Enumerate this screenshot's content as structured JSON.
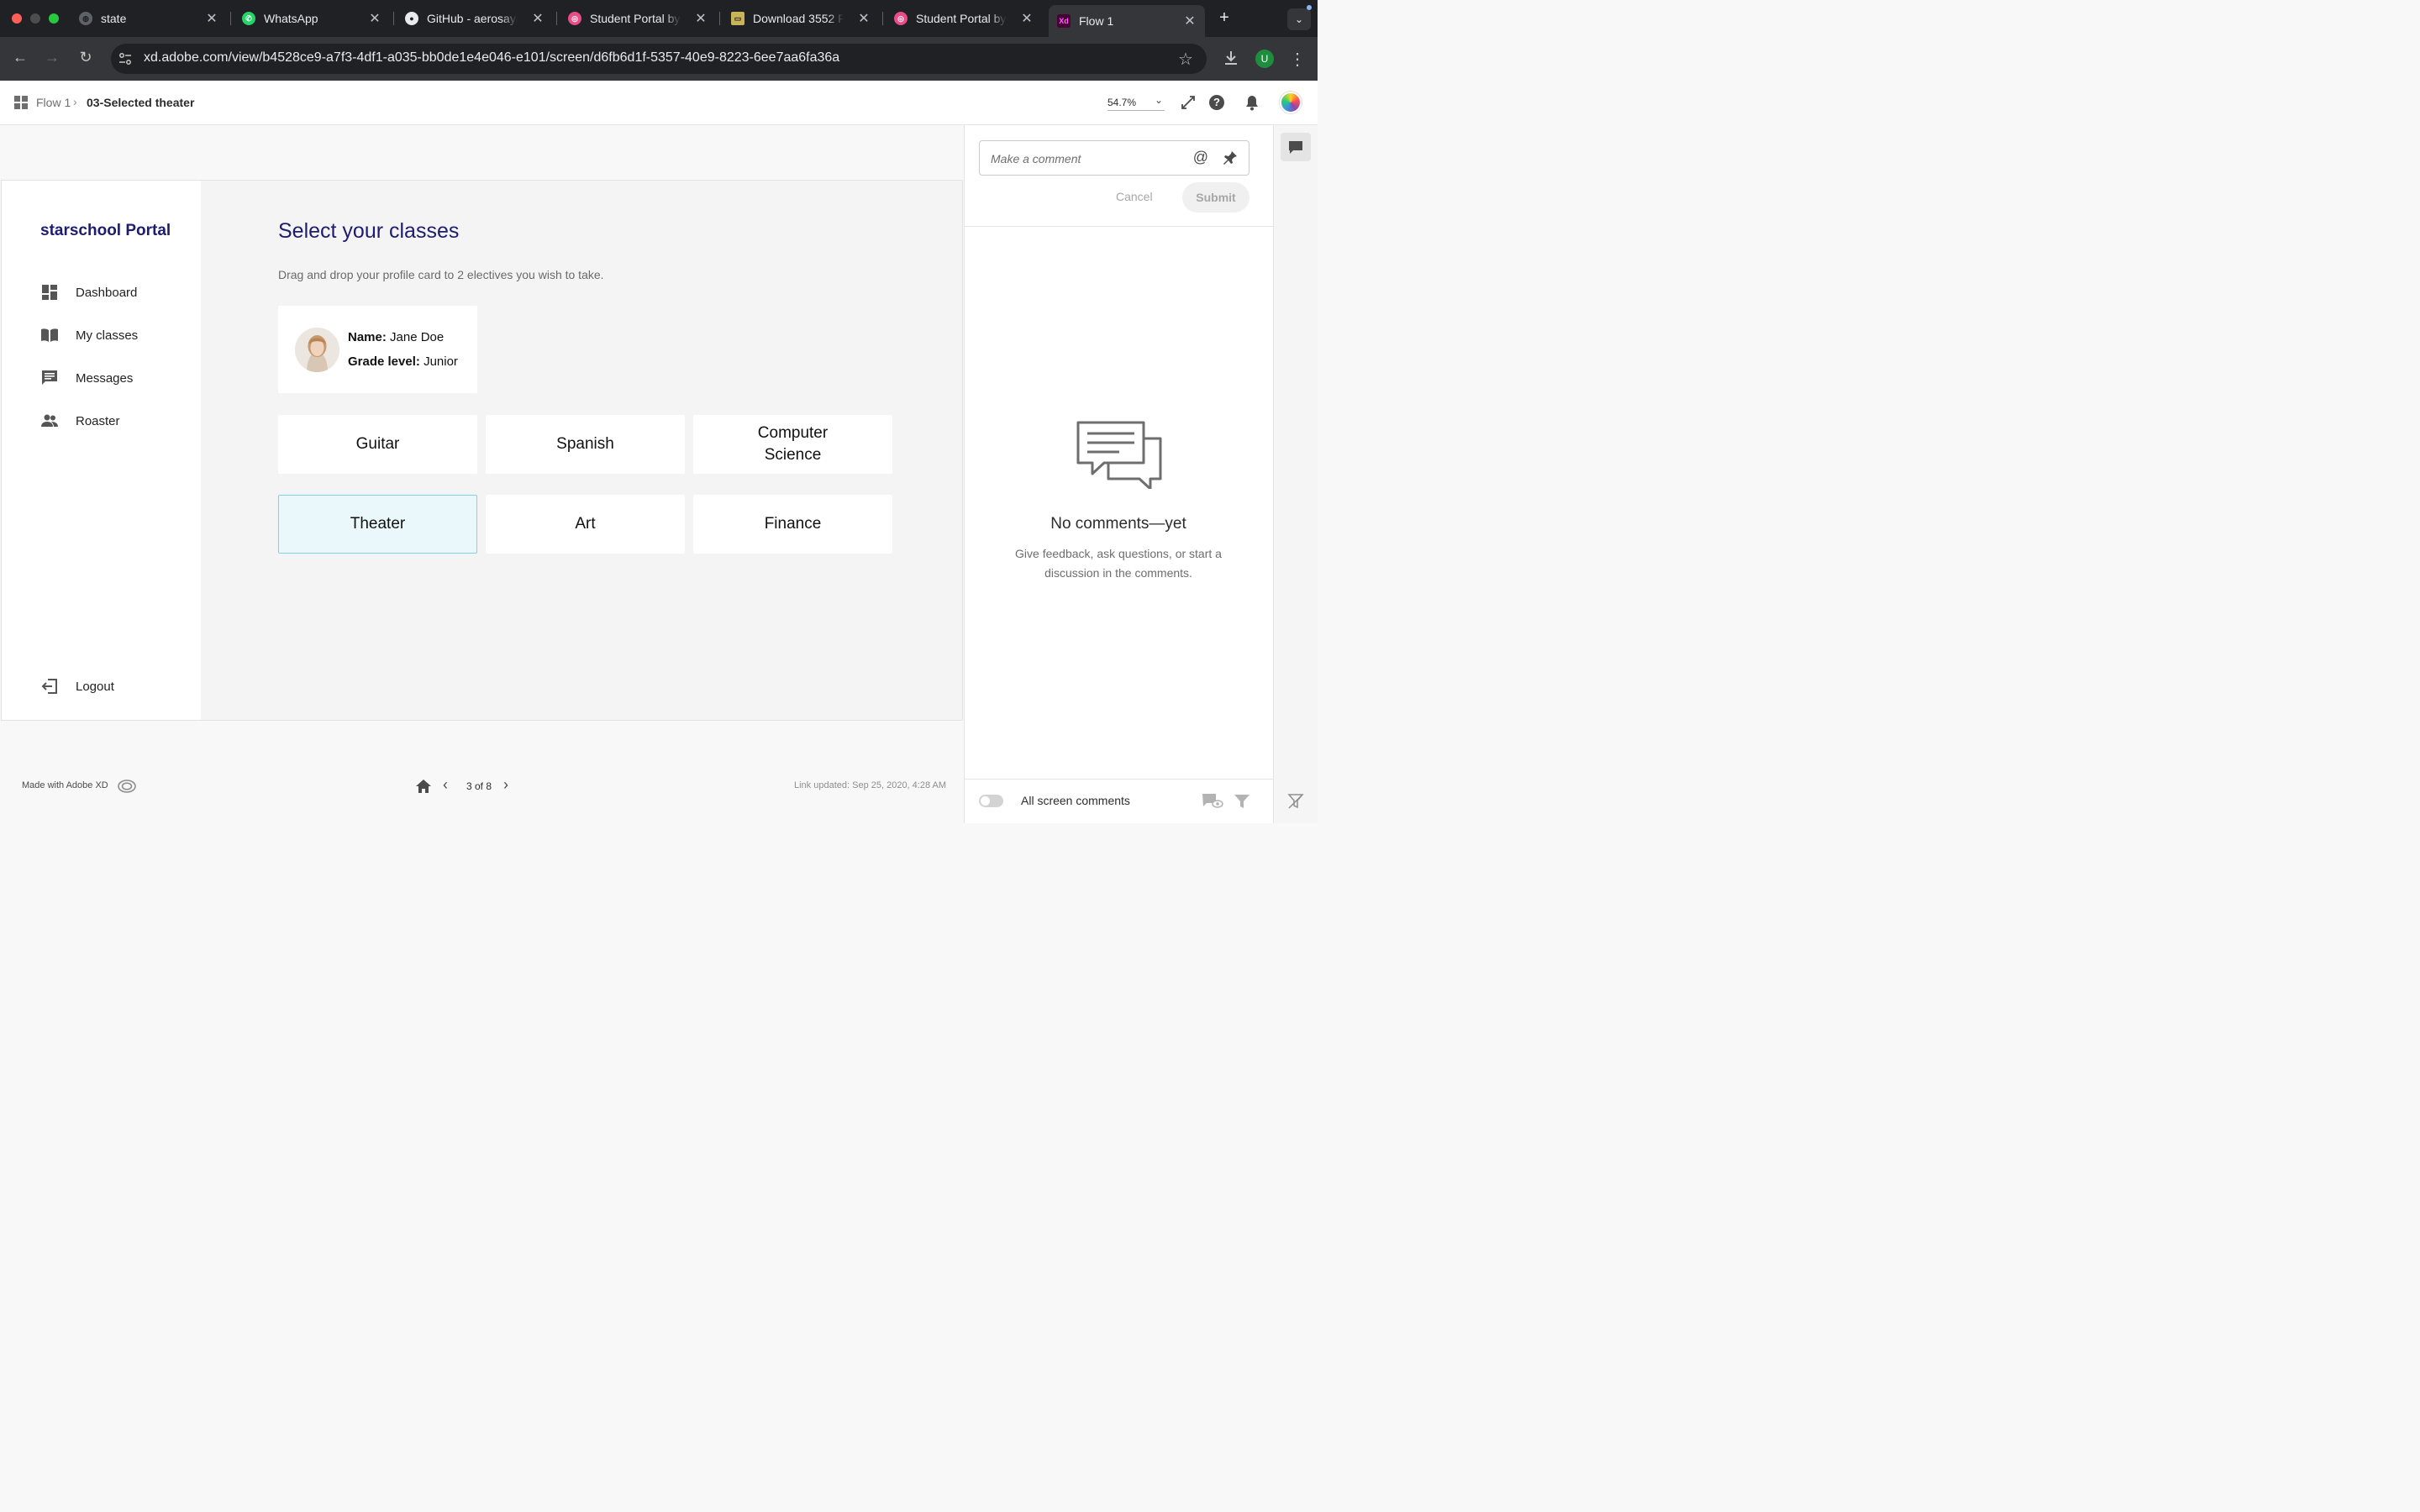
{
  "browser": {
    "tabs": [
      {
        "label": "state",
        "icon": "globe-icon"
      },
      {
        "label": "WhatsApp",
        "icon": "whatsapp-icon"
      },
      {
        "label": "GitHub - aerosayan",
        "icon": "github-icon"
      },
      {
        "label": "Student Portal by A",
        "icon": "dribbble-icon"
      },
      {
        "label": "Download 3552 Fre",
        "icon": "image-icon"
      },
      {
        "label": "Student Portal by A",
        "icon": "dribbble-icon"
      },
      {
        "label": "Flow 1",
        "icon": "xd-icon",
        "favicon_text": "Xd"
      }
    ],
    "url": "xd.adobe.com/view/b4528ce9-a7f3-4df1-a035-bb0de1e4e046-e101/screen/d6fb6d1f-5357-40e9-8223-6ee7aa6fa36a",
    "profile_initial": "U"
  },
  "xd_header": {
    "breadcrumb_root": "Flow 1",
    "breadcrumb_current": "03-Selected theater",
    "zoom": "54.7%"
  },
  "portal": {
    "brand": "starschool Portal",
    "nav": [
      {
        "label": "Dashboard",
        "icon": "dashboard-icon"
      },
      {
        "label": "My classes",
        "icon": "book-icon"
      },
      {
        "label": "Messages",
        "icon": "message-icon"
      },
      {
        "label": "Roaster",
        "icon": "people-icon"
      }
    ],
    "logout": "Logout",
    "title": "Select your classes",
    "subtitle": "Drag and drop your profile card to 2 electives you wish to take.",
    "profile": {
      "name_label": "Name:",
      "name": "Jane Doe",
      "grade_label": "Grade level:",
      "grade": "Junior"
    },
    "classes": [
      {
        "label": "Guitar",
        "selected": false
      },
      {
        "label": "Spanish",
        "selected": false
      },
      {
        "label": "Computer Science",
        "selected": false
      },
      {
        "label": "Theater",
        "selected": true
      },
      {
        "label": "Art",
        "selected": false
      },
      {
        "label": "Finance",
        "selected": false
      }
    ]
  },
  "footer": {
    "made_with": "Made with Adobe XD",
    "pagination": "3 of 8",
    "link_updated": "Link updated: Sep 25, 2020, 4:28 AM"
  },
  "comments": {
    "placeholder": "Make a comment",
    "cancel": "Cancel",
    "submit": "Submit",
    "empty_title": "No comments—yet",
    "empty_text": "Give feedback, ask questions, or start a discussion in the comments.",
    "all_screen": "All screen comments"
  },
  "colors": {
    "brand": "#1e1c6e",
    "selected_bg": "#eaf8fb",
    "selected_border": "#7fd3e6",
    "chrome_dark": "#202124",
    "chrome_toolbar": "#35363a"
  }
}
